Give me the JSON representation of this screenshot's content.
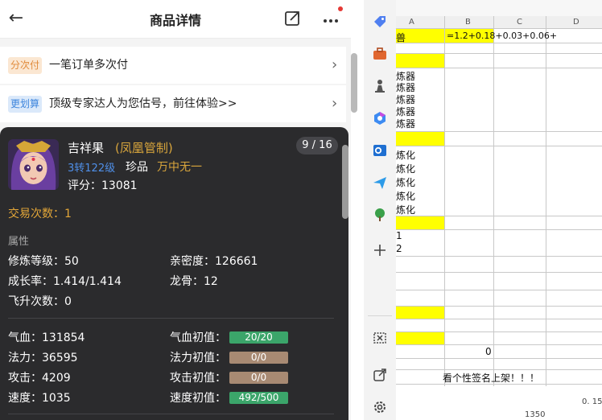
{
  "header": {
    "title": "商品详情",
    "back_icon": "arrow-left-icon",
    "share_icon": "share-icon",
    "more_icon": "more-dots-icon",
    "notification_dot_color": "#e53935"
  },
  "promos": [
    {
      "tag": "分次付",
      "text": "一笔订单多次付"
    },
    {
      "tag": "更划算",
      "text": "顶级专家达人为您估号，前往体验>>"
    }
  ],
  "pet": {
    "name": "吉祥果",
    "kind": "(凤凰管制)",
    "level": "3转122级",
    "rank": "珍品",
    "grade": "万中无一",
    "score": "评分：13081",
    "page": "9 / 16",
    "trade_count": "交易次数：1",
    "attr_title": "属性",
    "attrs": {
      "cultivation": "修炼等级：50",
      "intimacy": "亲密度：126661",
      "growth": "成长率：1.414/1.414",
      "dragon_bone": "龙骨：12",
      "ascension": "飞升次数：0"
    },
    "stats": [
      {
        "label": "气血：131854",
        "initial_label": "气血初值：",
        "initial": "20/20",
        "fraction": 1.0
      },
      {
        "label": "法力：36595",
        "initial_label": "法力初值：",
        "initial": "0/0",
        "fraction": 0.0
      },
      {
        "label": "攻击：4209",
        "initial_label": "攻击初值：",
        "initial": "0/0",
        "fraction": 0.0
      },
      {
        "label": "速度：1035",
        "initial_label": "速度初值：",
        "initial": "492/500",
        "fraction": 0.98
      }
    ],
    "colors": {
      "accent": "#d8a53c",
      "level": "#4f8fe8",
      "bar_green": "#3ba56a",
      "bar_tan": "#a88a73"
    }
  },
  "toolbar": {
    "icons": [
      "tag-icon",
      "briefcase-icon",
      "chess-pawn-icon",
      "copilot-icon",
      "outlook-icon",
      "send-icon",
      "tree-icon",
      "add-icon",
      "screenshot-icon",
      "open-external-icon",
      "settings-icon"
    ]
  },
  "sheet": {
    "columns": [
      "A",
      "B",
      "C",
      "D"
    ],
    "formula_cell": "=1.2+0.18+0.03+0.06+",
    "col_a_cells": [
      "兽",
      "炼器",
      "炼器",
      "炼器",
      "炼器",
      "炼器",
      "炼化",
      "炼化",
      "炼化",
      "炼化",
      "炼化",
      "1",
      "2"
    ],
    "zero_value": "0",
    "footer_text": "看个性签名上架！！！",
    "value_0_15": "0. 15",
    "value_1350": "1350",
    "highlight_color": "#ffff00"
  }
}
